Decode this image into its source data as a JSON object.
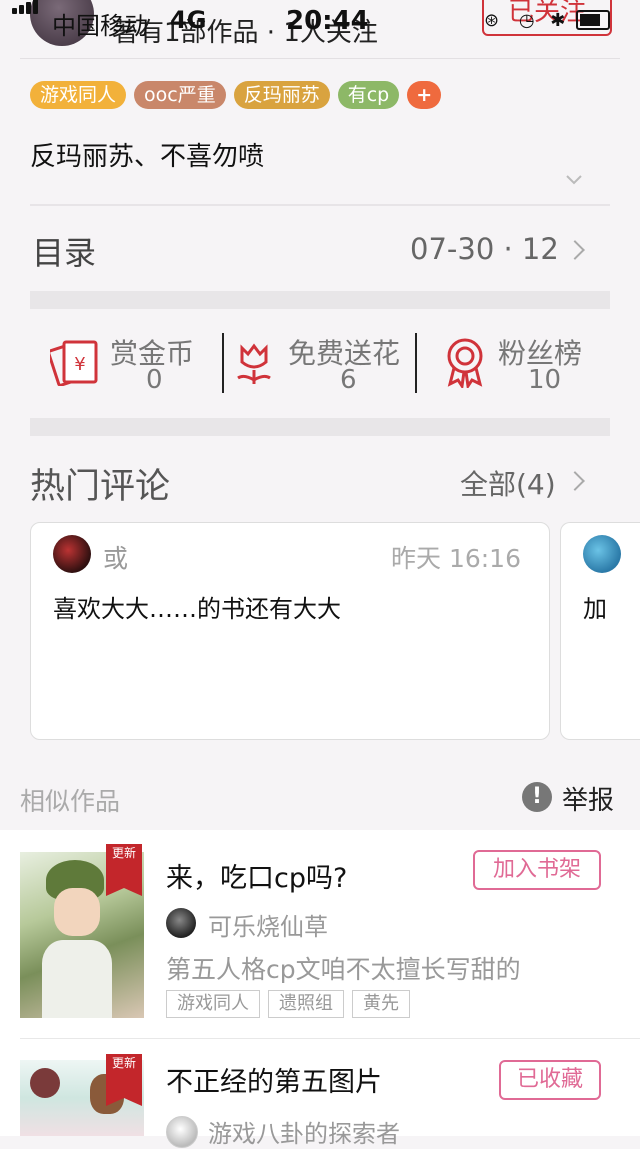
{
  "status_bar": {
    "carrier": "中国移动",
    "network": "4G",
    "time": "20:44"
  },
  "header": {
    "author_stats": "著有1部作品 · 1人关注",
    "follow_label": "已关注"
  },
  "book": {
    "tags": [
      {
        "label": "游戏同人",
        "color": "#f2b13a"
      },
      {
        "label": "ooc严重",
        "color": "#c9876a"
      },
      {
        "label": "反玛丽苏",
        "color": "#d9a33f"
      },
      {
        "label": "有cp",
        "color": "#8db867"
      },
      {
        "label": "+",
        "color": "#ef6a3e"
      }
    ],
    "description": "反玛丽苏、不喜勿喷"
  },
  "toc": {
    "title": "目录",
    "meta": "07-30 · 12"
  },
  "stats": [
    {
      "label": "赏金币",
      "value": "0",
      "icon": "red-envelope-icon"
    },
    {
      "label": "免费送花",
      "value": "6",
      "icon": "flower-icon"
    },
    {
      "label": "粉丝榜",
      "value": "10",
      "icon": "medal-icon"
    }
  ],
  "hot_comments": {
    "title": "热门评论",
    "all_label": "全部(4)",
    "items": [
      {
        "user": "或",
        "time": "昨天 16:16",
        "text": "喜欢大大……的书还有大大"
      },
      {
        "user": "",
        "time": "",
        "text": "加"
      }
    ]
  },
  "similar": {
    "title": "相似作品",
    "report_label": "举报",
    "books": [
      {
        "badge": "更新",
        "title": "来，吃口cp吗?",
        "button": "加入书架",
        "author": "可乐烧仙草",
        "summary": "第五人格cp文咱不太擅长写甜的",
        "tags": [
          "游戏同人",
          "遗照组",
          "黄先"
        ]
      },
      {
        "badge": "更新",
        "title": "不正经的第五图片",
        "button": "已收藏",
        "author": "游戏八卦的探索者",
        "summary": "",
        "tags": []
      }
    ]
  },
  "colors": {
    "accent_red": "#d0333a",
    "pink": "#e06a95"
  }
}
